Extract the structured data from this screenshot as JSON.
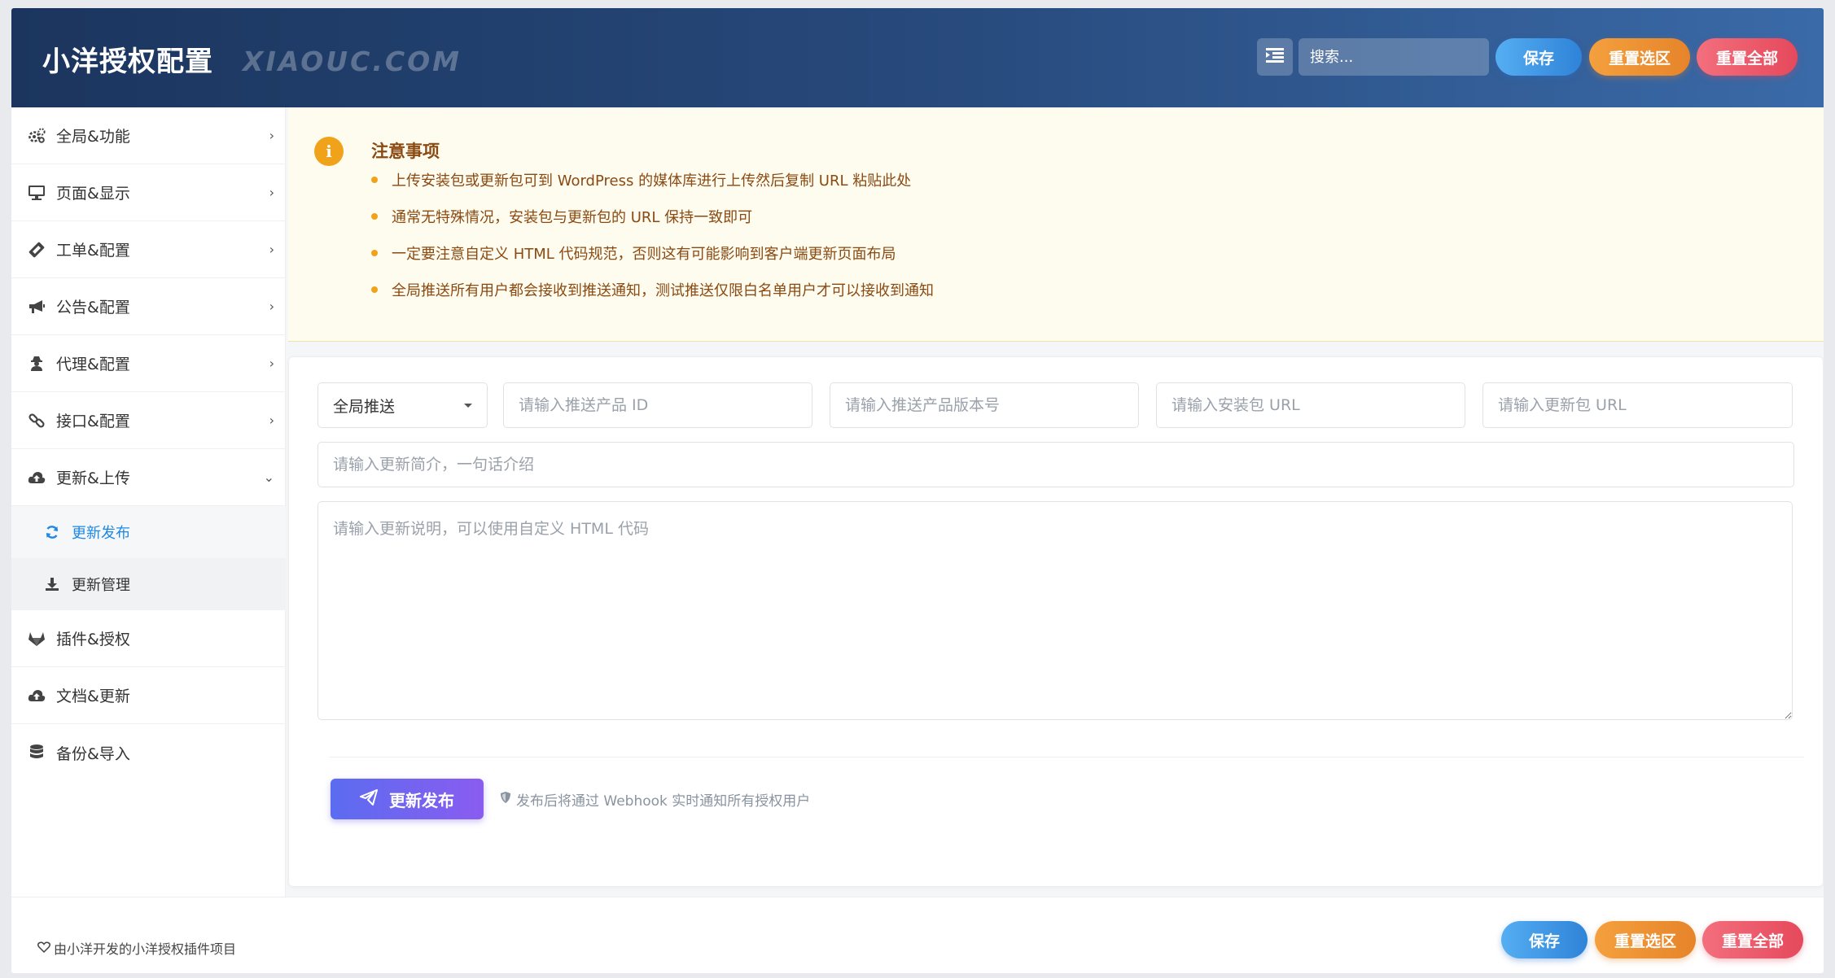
{
  "header": {
    "title": "小洋授权配置",
    "subtitle": "XIAOUC.COM",
    "search_placeholder": "搜索...",
    "save_label": "保存",
    "reset_section_label": "重置选区",
    "reset_all_label": "重置全部"
  },
  "sidebar": {
    "items": [
      {
        "label": "全局&功能",
        "icon": "gears-icon"
      },
      {
        "label": "页面&显示",
        "icon": "monitor-icon"
      },
      {
        "label": "工单&配置",
        "icon": "ticket-icon"
      },
      {
        "label": "公告&配置",
        "icon": "megaphone-icon"
      },
      {
        "label": "代理&配置",
        "icon": "user-secret-icon"
      },
      {
        "label": "接口&配置",
        "icon": "link-icon"
      },
      {
        "label": "更新&上传",
        "icon": "cloud-upload-icon"
      },
      {
        "label": "插件&授权",
        "icon": "gitlab-icon"
      },
      {
        "label": "文档&更新",
        "icon": "cloud-upload-icon"
      },
      {
        "label": "备份&导入",
        "icon": "database-icon"
      }
    ],
    "sub_items": [
      {
        "label": "更新发布",
        "icon": "refresh-icon",
        "active": true
      },
      {
        "label": "更新管理",
        "icon": "download-icon",
        "active": false
      }
    ]
  },
  "notice": {
    "title": "注意事项",
    "lines": [
      "上传安装包或更新包可到 WordPress 的媒体库进行上传然后复制 URL 粘贴此处",
      "通常无特殊情况，安装包与更新包的 URL 保持一致即可",
      "一定要注意自定义 HTML 代码规范，否则这有可能影响到客户端更新页面布局",
      "全局推送所有用户都会接收到推送通知，测试推送仅限白名单用户才可以接收到通知"
    ]
  },
  "form": {
    "push_type_value": "全局推送",
    "product_id_placeholder": "请输入推送产品 ID",
    "version_placeholder": "请输入推送产品版本号",
    "install_url_placeholder": "请输入安装包 URL",
    "update_url_placeholder": "请输入更新包 URL",
    "summary_placeholder": "请输入更新简介，一句话介绍",
    "description_placeholder": "请输入更新说明，可以使用自定义 HTML 代码",
    "publish_label": "更新发布",
    "publish_hint": "发布后将通过 Webhook 实时通知所有授权用户"
  },
  "footer": {
    "text": "由小洋开发的小洋授权插件项目",
    "save_label": "保存",
    "reset_section_label": "重置选区",
    "reset_all_label": "重置全部"
  },
  "colors": {
    "header_start": "#1b355e",
    "header_end": "#3a6aa8",
    "accent_blue": "#2f83d8",
    "accent_orange": "#e6842a",
    "accent_red": "#e5495c",
    "notice_text": "#8a4a12",
    "active_sub": "#1e88e5",
    "publish_purple": "#6f63f0"
  }
}
